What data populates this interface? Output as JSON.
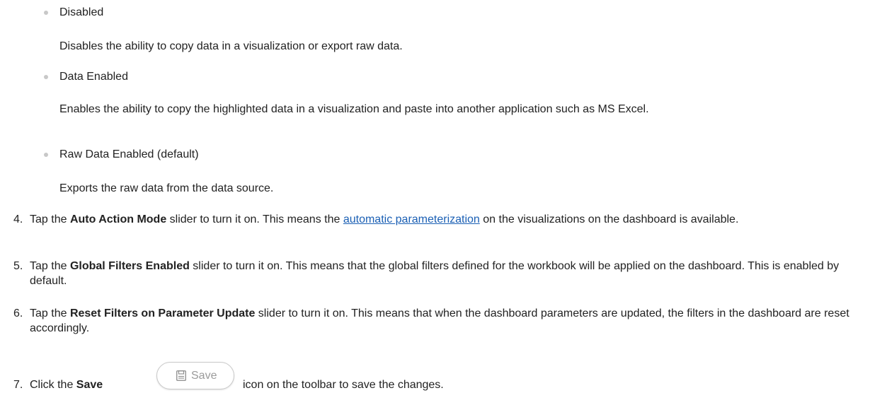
{
  "permissions_options": [
    {
      "title": "Disabled",
      "description": "Disables the ability to copy data in a visualization or export raw data."
    },
    {
      "title": "Data Enabled",
      "description": "Enables the ability to copy the highlighted data in a visualization and paste into another application such as MS Excel."
    },
    {
      "title": "Raw Data Enabled (default)",
      "description": "Exports the raw data from the data source."
    }
  ],
  "steps": [
    {
      "number": "4.",
      "prefix": "Tap the ",
      "bold": "Auto Action Mode",
      "middle": " slider to turn it on. This means the ",
      "link": "automatic parameterization",
      "suffix": " on the visualizations on the dashboard is available."
    },
    {
      "number": "5.",
      "prefix": "Tap the ",
      "bold": "Global Filters Enabled",
      "suffix": " slider to turn it on. This means that the global filters defined for the workbook will be applied on the dashboard. This is enabled by default."
    },
    {
      "number": "6.",
      "prefix": "Tap the ",
      "bold": "Reset Filters on Parameter Update",
      "suffix": " slider to turn it on. This means that when the dashboard parameters are updated, the filters in the dashboard are reset accordingly."
    },
    {
      "number": "7.",
      "prefix": "Click the ",
      "bold": "Save",
      "suffix": "icon on the toolbar to save the changes."
    }
  ],
  "save_button": {
    "label": "Save",
    "icon": "save-icon"
  }
}
